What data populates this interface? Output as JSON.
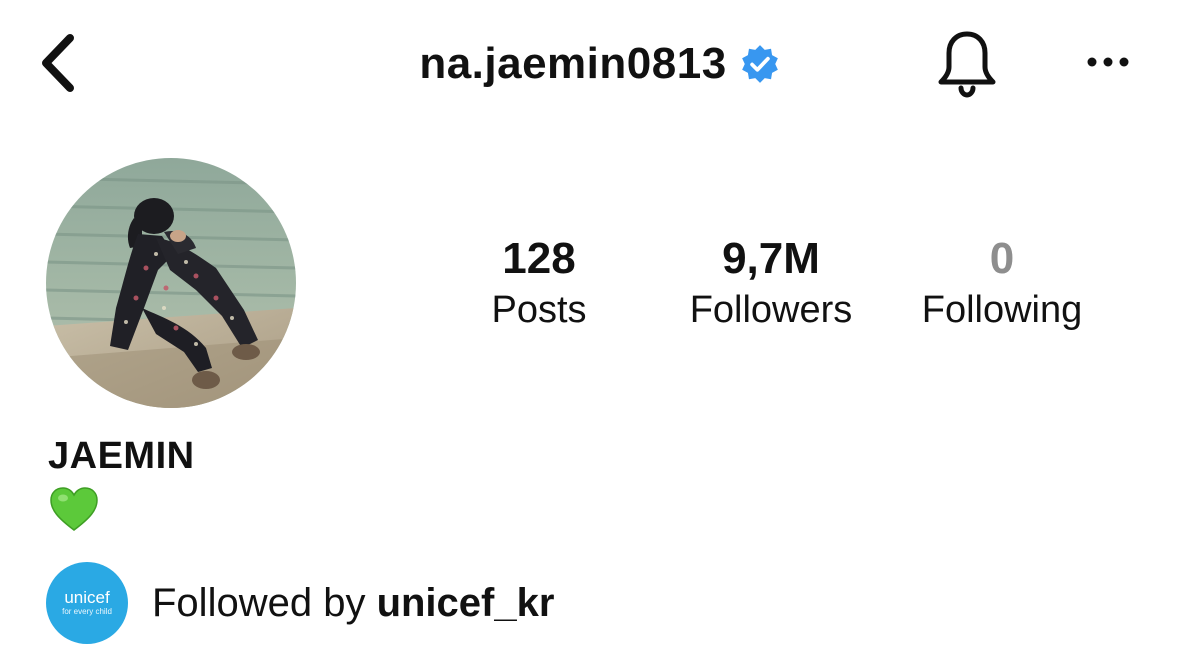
{
  "header": {
    "back_icon": "chevron-left-icon",
    "username": "na.jaemin0813",
    "verified_icon": "verified-badge-icon",
    "notification_icon": "bell-icon",
    "more_icon": "more-horizontal-icon"
  },
  "profile": {
    "avatar_icon": "profile-photo",
    "stats": [
      {
        "value": "128",
        "label": "Posts"
      },
      {
        "value": "9,7M",
        "label": "Followers"
      },
      {
        "value": "0",
        "label": "Following"
      }
    ],
    "display_name": "JAEMIN",
    "bio_emoji": "green-heart-icon"
  },
  "followed_by": {
    "prefix": "Followed by ",
    "account": "unicef_kr",
    "avatar_line1": "unicef",
    "avatar_line2": "for every child"
  },
  "colors": {
    "verified": "#3897f0",
    "heart": "#5cc93a",
    "unicef": "#2aa9e4",
    "muted": "#8e8e8e"
  }
}
